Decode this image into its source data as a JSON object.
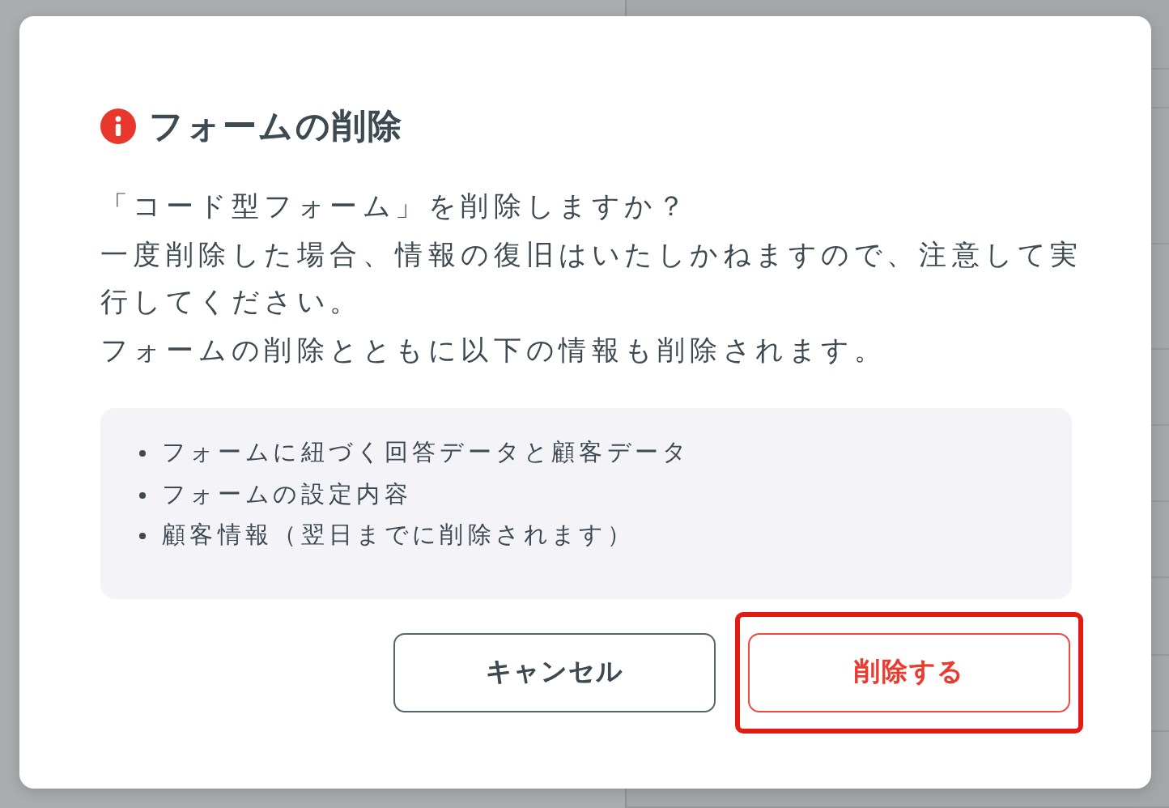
{
  "dialog": {
    "title": "フォームの削除",
    "paragraphs": [
      "「コード型フォーム」を削除しますか？",
      "一度削除した場合、情報の復旧はいたしかねますので、注意して実行してください。",
      "フォームの削除とともに以下の情報も削除されます。"
    ],
    "items": [
      "フォームに紐づく回答データと顧客データ",
      "フォームの設定内容",
      "顧客情報（翌日までに削除されます）"
    ],
    "buttons": [
      {
        "label": "キャンセル",
        "kind": "secondary",
        "highlighted": false
      },
      {
        "label": "削除する",
        "kind": "danger",
        "highlighted": true
      }
    ]
  }
}
